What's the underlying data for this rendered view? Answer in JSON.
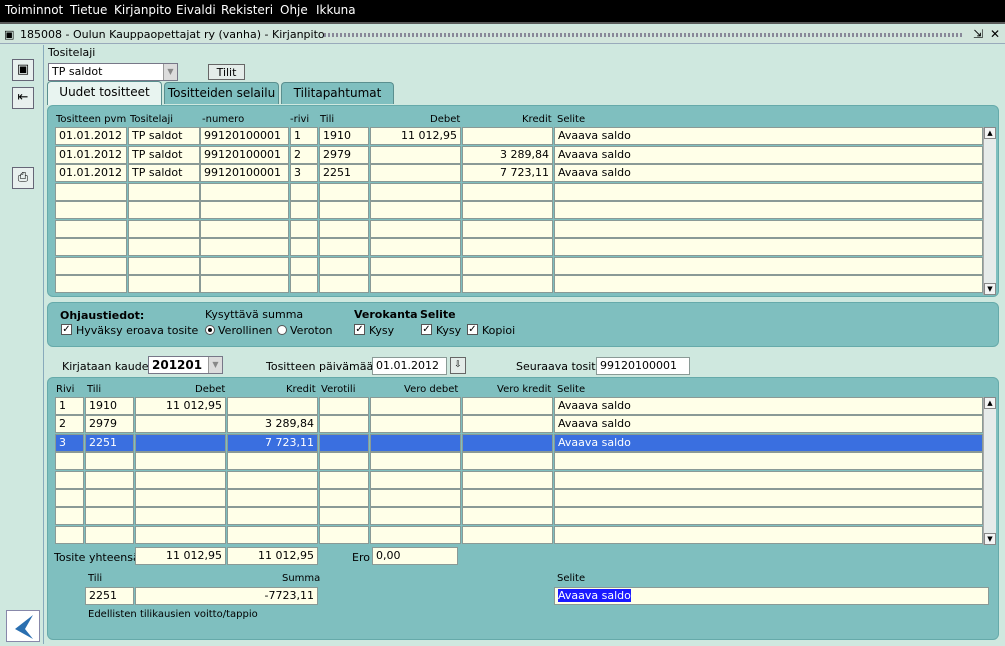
{
  "menu": [
    "Toiminnot",
    "Tietue",
    "Kirjanpito",
    "Eivaldi",
    "Rekisteri",
    "Ohje",
    "Ikkuna"
  ],
  "window": {
    "title": "185008 - Oulun Kauppaopettajat ry (vanha) - Kirjanpito"
  },
  "tositelaji": {
    "label": "Tositelaji",
    "value": "TP saldot",
    "tilit_button": "Tilit"
  },
  "tabs": [
    "Uudet tositteet",
    "Tositteiden selailu",
    "Tilitapahtumat"
  ],
  "grid1": {
    "headers": [
      "Tositteen pvm",
      "Tositelaji",
      "-numero",
      "-rivi",
      "Tili",
      "Debet",
      "Kredit",
      "Selite"
    ],
    "rows": [
      [
        "01.01.2012",
        "TP saldot",
        "99120100001",
        "1",
        "1910",
        "11 012,95",
        "",
        "Avaava saldo"
      ],
      [
        "01.01.2012",
        "TP saldot",
        "99120100001",
        "2",
        "2979",
        "",
        "3 289,84",
        "Avaava saldo"
      ],
      [
        "01.01.2012",
        "TP saldot",
        "99120100001",
        "3",
        "2251",
        "",
        "7 723,11",
        "Avaava saldo"
      ]
    ]
  },
  "ohjaus": {
    "title": "Ohjaustiedot:",
    "accept_label": "Hyväksy eroava tosite",
    "sum_title": "Kysyttävä summa",
    "verollinen": "Verollinen",
    "veroton": "Veroton",
    "verokanta_title": "Verokanta",
    "verokanta_kysy": "Kysy",
    "selite_title": "Selite",
    "selite_kysy": "Kysy",
    "selite_kopioi": "Kopioi"
  },
  "kausi": {
    "label": "Kirjataan kaudelle",
    "value": "201201"
  },
  "pvm": {
    "label": "Tositteen päivämäärä",
    "value": "01.01.2012"
  },
  "seuraava": {
    "label": "Seuraava tosite",
    "value": "99120100001"
  },
  "grid2": {
    "headers": [
      "Rivi",
      "Tili",
      "Debet",
      "Kredit",
      "Verotili",
      "Vero debet",
      "Vero kredit",
      "Selite"
    ],
    "rows": [
      [
        "1",
        "1910",
        "11 012,95",
        "",
        "",
        "",
        "",
        "Avaava saldo"
      ],
      [
        "2",
        "2979",
        "",
        "3 289,84",
        "",
        "",
        "",
        "Avaava saldo"
      ],
      [
        "3",
        "2251",
        "",
        "7 723,11",
        "",
        "",
        "",
        "Avaava saldo"
      ]
    ],
    "selected_row": 3
  },
  "totals": {
    "label": "Tosite yhteensä",
    "debet": "11 012,95",
    "kredit": "11 012,95",
    "ero_label": "Ero",
    "ero": "0,00"
  },
  "detail": {
    "tili_label": "Tili",
    "tili": "2251",
    "summa_label": "Summa",
    "summa": "-7723,11",
    "selite_label": "Selite",
    "selite": "Avaava saldo",
    "account_name": "Edellisten tilikausien voitto/tappio"
  },
  "colors": {
    "selection": "#3a6fe0",
    "panel": "#7fbfbf",
    "field": "#ffffe8"
  }
}
